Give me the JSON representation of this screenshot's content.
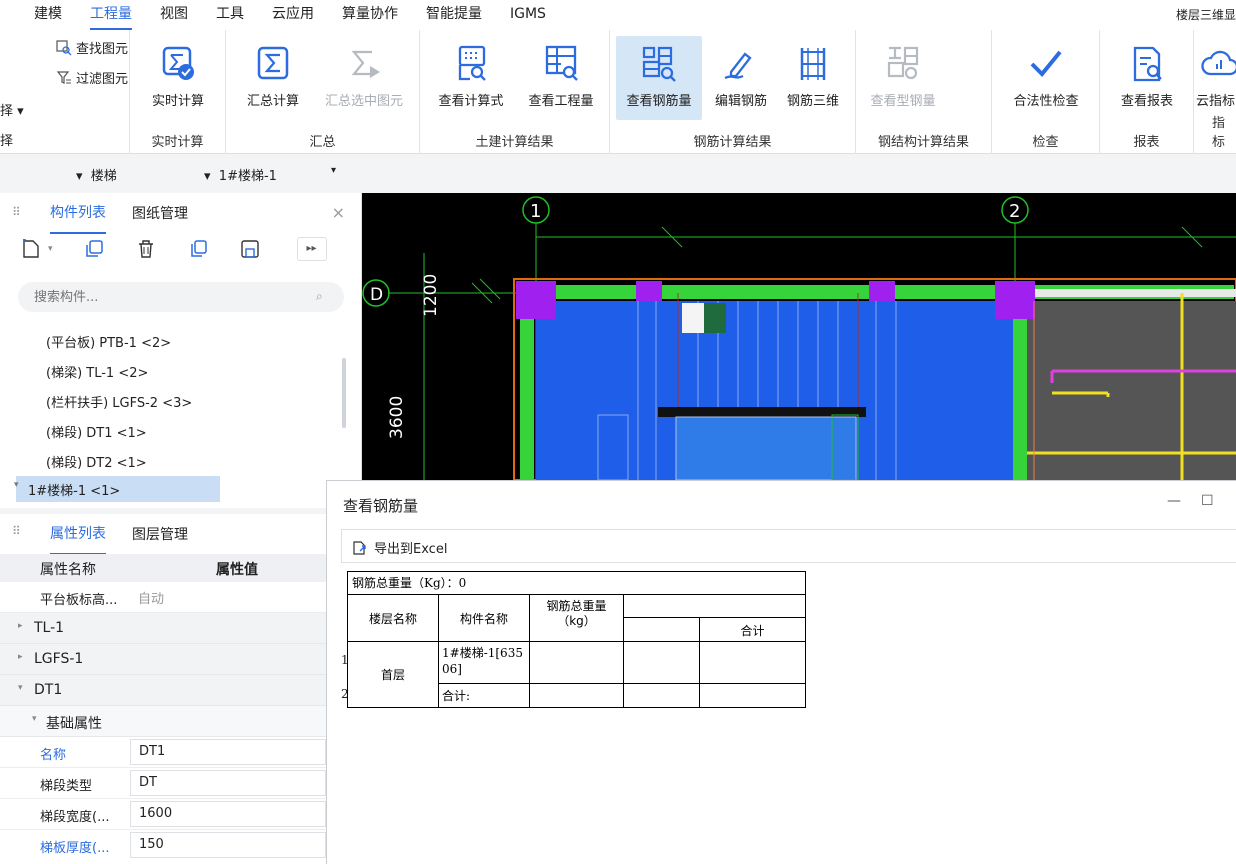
{
  "menu": {
    "items": [
      "建模",
      "工程量",
      "视图",
      "工具",
      "云应用",
      "算量协作",
      "智能提量",
      "IGMS"
    ],
    "active_index": 1,
    "right_label": "楼层三维显"
  },
  "ribbon": {
    "find_element": "查找图元",
    "filter_element": "过滤图元",
    "select_partial": "择",
    "select_group_partial": "择",
    "realtime_calc": "实时计算",
    "realtime_group": "实时计算",
    "sum_calc": "汇总计算",
    "sum_selected": "汇总选中图元",
    "sum_group": "汇总",
    "view_formula": "查看计算式",
    "view_quantity": "查看工程量",
    "civil_group": "土建计算结果",
    "view_rebar": "查看钢筋量",
    "edit_rebar": "编辑钢筋",
    "rebar_3d": "钢筋三维",
    "rebar_group": "钢筋计算结果",
    "view_steel": "查看型钢量",
    "steel_group": "钢结构计算结果",
    "legality_check": "合法性检查",
    "check_group": "检查",
    "view_report": "查看报表",
    "report_group": "报表",
    "cloud_index": "云指标",
    "index_group": "指标"
  },
  "selectors": {
    "type": "楼梯",
    "component": "1#楼梯-1"
  },
  "component_panel": {
    "tabs": [
      "构件列表",
      "图纸管理"
    ],
    "search_placeholder": "搜索构件...",
    "items": [
      "(平台板) PTB-1 <2>",
      "(梯梁) TL-1 <2>",
      "(栏杆扶手) LGFS-2 <3>",
      "(梯段) DT1 <1>",
      "(梯段) DT2 <1>"
    ],
    "selected": "1#楼梯-1 <1>"
  },
  "property_panel": {
    "tabs": [
      "属性列表",
      "图层管理"
    ],
    "col_name": "属性名称",
    "col_value": "属性值",
    "first_row_name": "平台板标高...",
    "first_row_value": "自动",
    "sections": [
      "TL-1",
      "LGFS-1",
      "DT1"
    ],
    "subsection": "基础属性",
    "rows": [
      {
        "name": "名称",
        "value": "DT1",
        "highlight": true
      },
      {
        "name": "梯段类型",
        "value": "DT",
        "highlight": false
      },
      {
        "name": "梯段宽度(...",
        "value": "1600",
        "highlight": false
      },
      {
        "name": "梯板厚度(...",
        "value": "150",
        "highlight": true
      }
    ]
  },
  "cad": {
    "axis_1": "1",
    "axis_2": "2",
    "axis_d": "D",
    "dim_1200": "1200",
    "dim_3600": "3600"
  },
  "dialog": {
    "title": "查看钢筋量",
    "minimize": "—",
    "maximize": "☐",
    "export_label": "导出到Excel",
    "table": {
      "total_weight": "钢筋总重量（Kg）：0",
      "col_floor": "楼层名称",
      "col_component": "构件名称",
      "col_weight": "钢筋总重量（kg）",
      "col_total": "合计",
      "row1_num": "1",
      "row2_num": "2",
      "floor": "首层",
      "component": "1#楼梯-1[63506]",
      "sum_label": "合计:"
    }
  },
  "colors": {
    "accent": "#2d6cdf",
    "selected_bg": "#c9def4",
    "cad_bg": "#000000",
    "cad_blue": "#1e5ee8",
    "cad_green": "#36d43a",
    "cad_purple": "#a020f0",
    "cad_orange": "#e06a10"
  }
}
